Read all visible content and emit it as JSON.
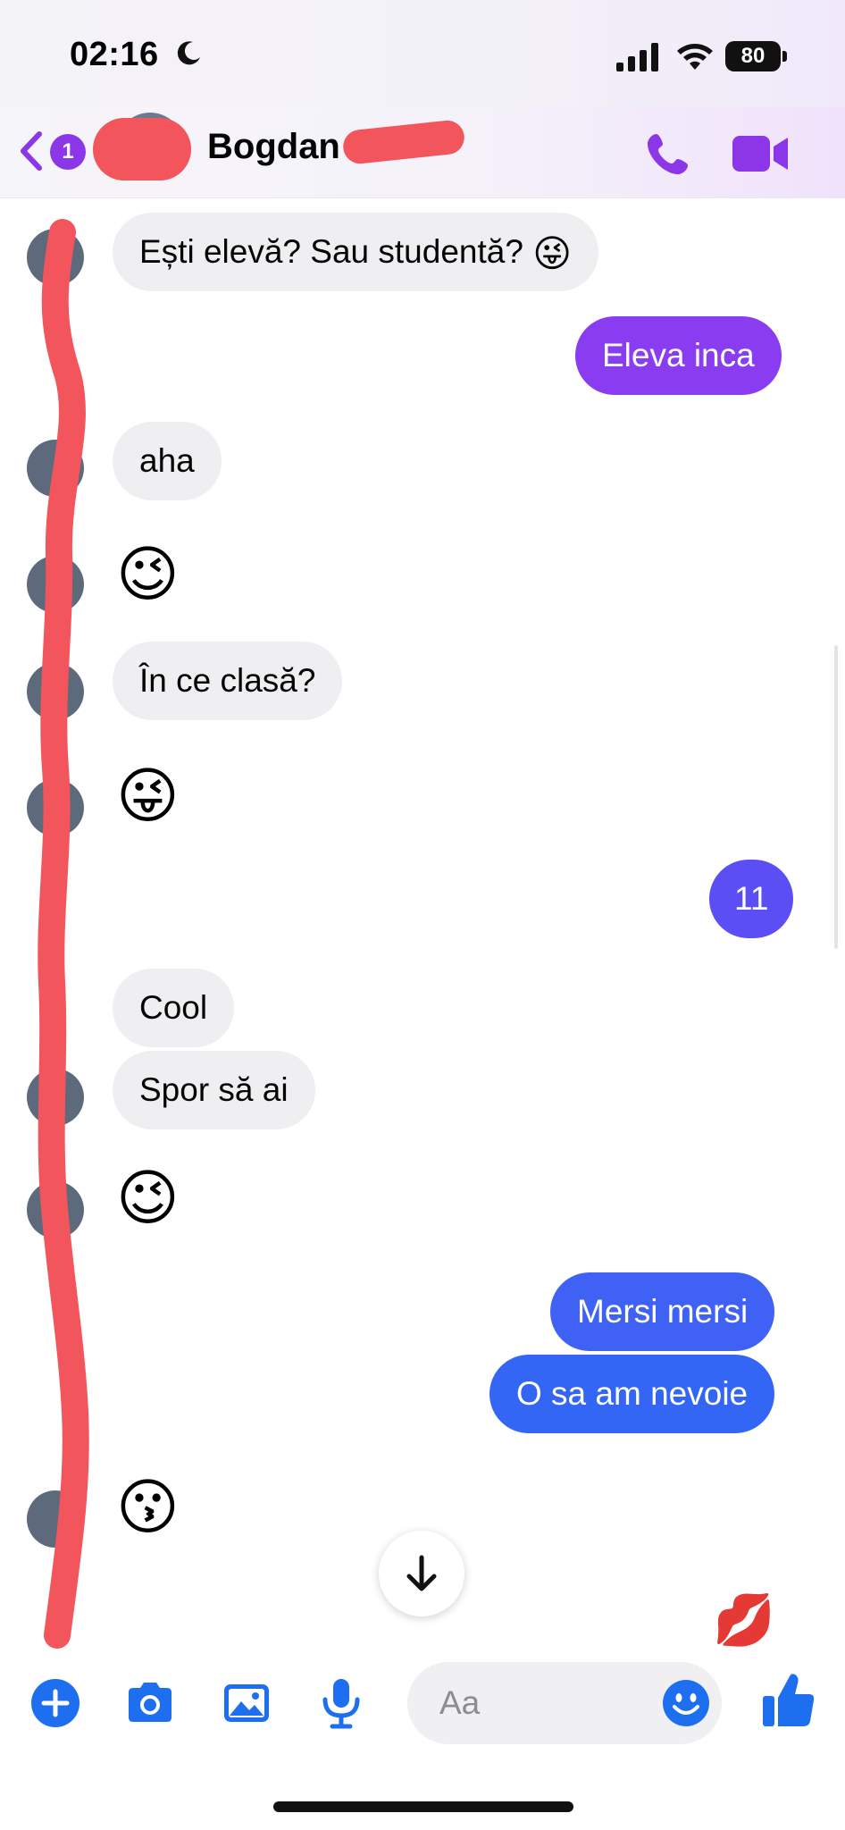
{
  "status_bar": {
    "time": "02:16",
    "battery": "80"
  },
  "header": {
    "back_badge": "1",
    "contact_name": "Bogdan"
  },
  "messages": [
    {
      "side": "in",
      "text": "Ești elevă? Sau studentă?",
      "emoji": "😜"
    },
    {
      "side": "out",
      "text": "Eleva inca"
    },
    {
      "side": "in",
      "text": "aha"
    },
    {
      "side": "in",
      "emoji": "😉"
    },
    {
      "side": "in",
      "text": "În ce clasă?"
    },
    {
      "side": "in",
      "emoji": "😜"
    },
    {
      "side": "out",
      "text": "11"
    },
    {
      "side": "in",
      "text": "Cool"
    },
    {
      "side": "in",
      "text": "Spor să ai"
    },
    {
      "side": "in",
      "emoji": "😉"
    },
    {
      "side": "out",
      "text": "Mersi mersi"
    },
    {
      "side": "out",
      "text": "O sa am nevoie"
    },
    {
      "side": "in",
      "emoji": "😗"
    }
  ],
  "reaction": "💋",
  "composer": {
    "placeholder": "Aa"
  },
  "icons": [
    "moon-icon",
    "signal-icon",
    "wifi-icon",
    "back-chevron-icon",
    "phone-icon",
    "video-icon",
    "arrow-down-icon",
    "plus-icon",
    "camera-icon",
    "gallery-icon",
    "microphone-icon",
    "smile-icon",
    "thumbs-up-icon"
  ],
  "colors": {
    "accent_purple": "#8b37e8",
    "bubble_purple": "#8a3cf0",
    "bubble_violet": "#5b4ef5",
    "bubble_blue": "#3366f5",
    "incoming_bubble": "#efeff1",
    "composer_blue": "#1e6ef0",
    "redaction": "#f2555c"
  }
}
